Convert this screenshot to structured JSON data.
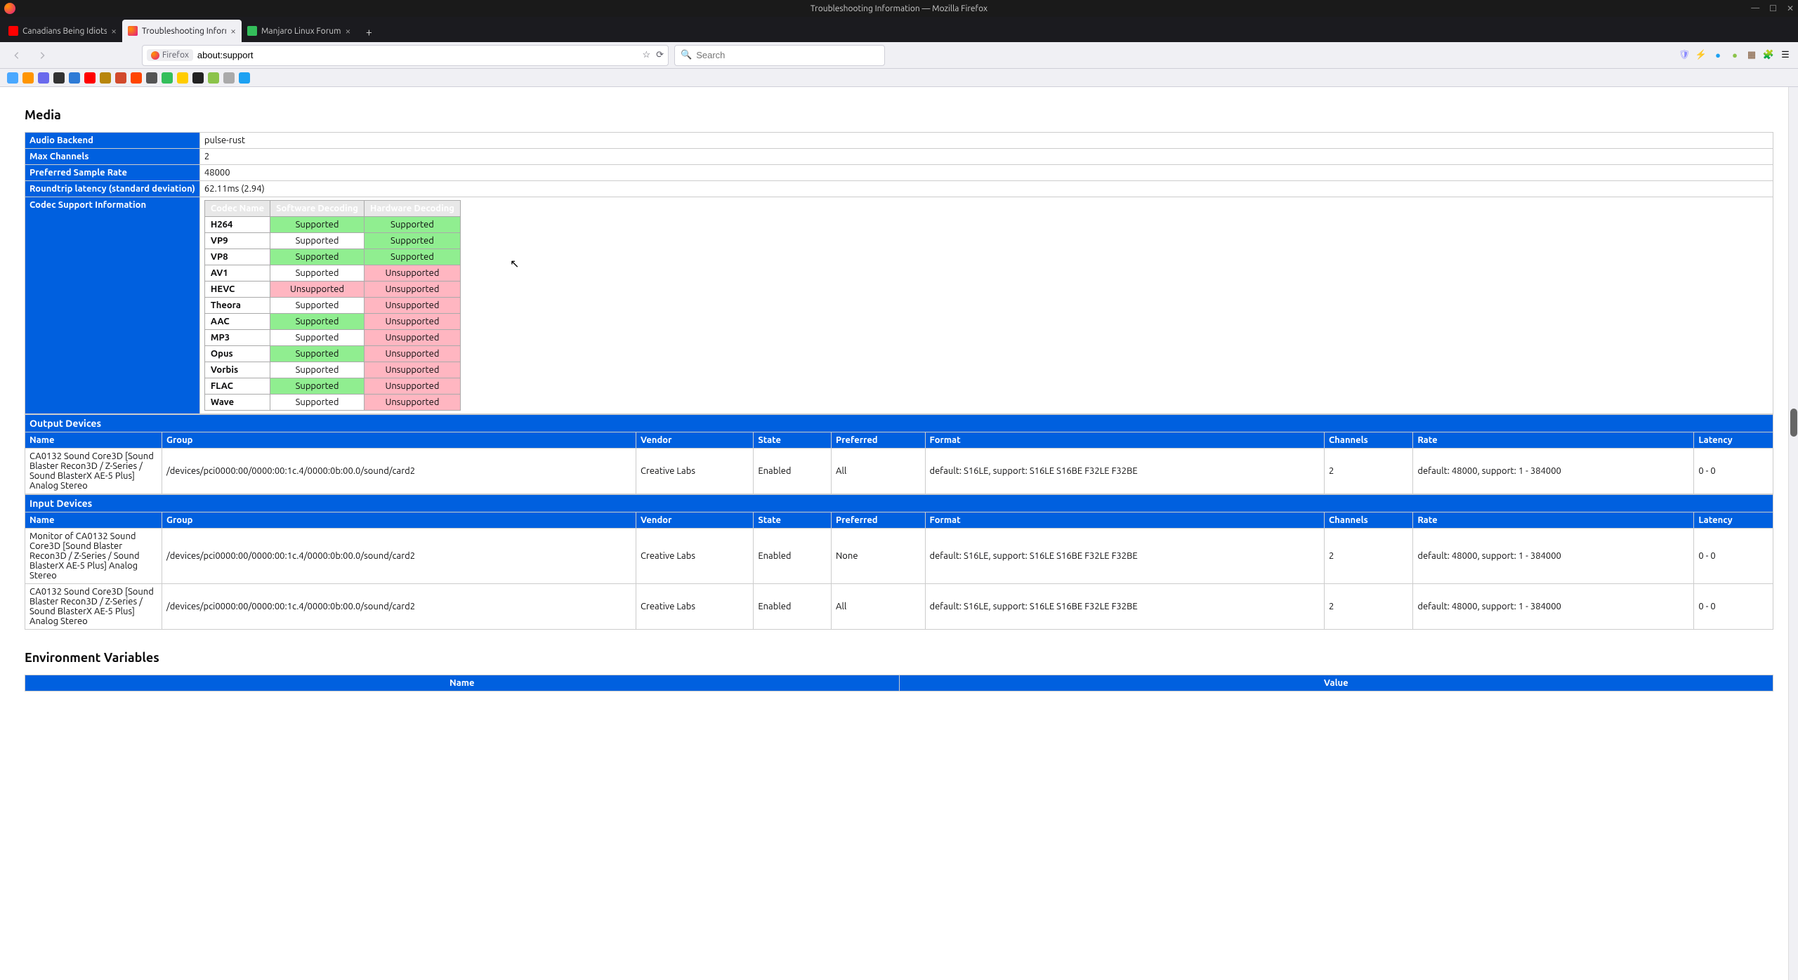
{
  "window": {
    "title": "Troubleshooting Information — Mozilla Firefox"
  },
  "tabs": [
    {
      "label": "Canadians Being Idiots | F",
      "active": false
    },
    {
      "label": "Troubleshooting Informati",
      "active": true
    },
    {
      "label": "Manjaro Linux Forum",
      "active": false
    }
  ],
  "urlbar": {
    "identity": "Firefox",
    "url": "about:support"
  },
  "searchbar": {
    "placeholder": "Search"
  },
  "media": {
    "section_title": "Media",
    "rows": {
      "audio_backend_label": "Audio Backend",
      "audio_backend_value": "pulse-rust",
      "max_channels_label": "Max Channels",
      "max_channels_value": "2",
      "sample_rate_label": "Preferred Sample Rate",
      "sample_rate_value": "48000",
      "latency_label": "Roundtrip latency (standard deviation)",
      "latency_value": "62.11ms (2.94)",
      "codec_label": "Codec Support Information"
    },
    "codec_headers": {
      "name": "Codec Name",
      "sw": "Software Decoding",
      "hw": "Hardware Decoding"
    },
    "codecs": [
      {
        "name": "H264",
        "sw": "Supported",
        "hw": "Supported",
        "sw_alt": false
      },
      {
        "name": "VP9",
        "sw": "Supported",
        "hw": "Supported",
        "sw_alt": true
      },
      {
        "name": "VP8",
        "sw": "Supported",
        "hw": "Supported",
        "sw_alt": false
      },
      {
        "name": "AV1",
        "sw": "Supported",
        "hw": "Unsupported",
        "sw_alt": true
      },
      {
        "name": "HEVC",
        "sw": "Unsupported",
        "hw": "Unsupported",
        "sw_alt": false
      },
      {
        "name": "Theora",
        "sw": "Supported",
        "hw": "Unsupported",
        "sw_alt": true
      },
      {
        "name": "AAC",
        "sw": "Supported",
        "hw": "Unsupported",
        "sw_alt": false
      },
      {
        "name": "MP3",
        "sw": "Supported",
        "hw": "Unsupported",
        "sw_alt": true
      },
      {
        "name": "Opus",
        "sw": "Supported",
        "hw": "Unsupported",
        "sw_alt": false
      },
      {
        "name": "Vorbis",
        "sw": "Supported",
        "hw": "Unsupported",
        "sw_alt": true
      },
      {
        "name": "FLAC",
        "sw": "Supported",
        "hw": "Unsupported",
        "sw_alt": false
      },
      {
        "name": "Wave",
        "sw": "Supported",
        "hw": "Unsupported",
        "sw_alt": true
      }
    ]
  },
  "devices": {
    "output_title": "Output Devices",
    "input_title": "Input Devices",
    "headers": {
      "name": "Name",
      "group": "Group",
      "vendor": "Vendor",
      "state": "State",
      "preferred": "Preferred",
      "format": "Format",
      "channels": "Channels",
      "rate": "Rate",
      "latency": "Latency"
    },
    "output": [
      {
        "name": "CA0132 Sound Core3D [Sound Blaster Recon3D / Z-Series / Sound BlasterX AE-5 Plus] Analog Stereo",
        "group": "/devices/pci0000:00/0000:00:1c.4/0000:0b:00.0/sound/card2",
        "vendor": "Creative Labs",
        "state": "Enabled",
        "preferred": "All",
        "format": "default: S16LE, support: S16LE S16BE F32LE F32BE",
        "channels": "2",
        "rate": "default: 48000, support: 1 - 384000",
        "latency": "0 - 0"
      }
    ],
    "input": [
      {
        "name": "Monitor of CA0132 Sound Core3D [Sound Blaster Recon3D / Z-Series / Sound BlasterX AE-5 Plus] Analog Stereo",
        "group": "/devices/pci0000:00/0000:00:1c.4/0000:0b:00.0/sound/card2",
        "vendor": "Creative Labs",
        "state": "Enabled",
        "preferred": "None",
        "format": "default: S16LE, support: S16LE S16BE F32LE F32BE",
        "channels": "2",
        "rate": "default: 48000, support: 1 - 384000",
        "latency": "0 - 0"
      },
      {
        "name": "CA0132 Sound Core3D [Sound Blaster Recon3D / Z-Series / Sound BlasterX AE-5 Plus] Analog Stereo",
        "group": "/devices/pci0000:00/0000:00:1c.4/0000:0b:00.0/sound/card2",
        "vendor": "Creative Labs",
        "state": "Enabled",
        "preferred": "All",
        "format": "default: S16LE, support: S16LE S16BE F32LE F32BE",
        "channels": "2",
        "rate": "default: 48000, support: 1 - 384000",
        "latency": "0 - 0"
      }
    ]
  },
  "env": {
    "section_title": "Environment Variables",
    "headers": {
      "name": "Name",
      "value": "Value"
    }
  },
  "bookmark_colors": [
    "#4aa8ff",
    "#ff9500",
    "#6a6aed",
    "#333",
    "#2e7bd6",
    "#f00",
    "#b8860b",
    "#d24a2c",
    "#ff4500",
    "#555",
    "#34be5b",
    "#ffcc00",
    "#222",
    "#8bc34a",
    "#aaa",
    "#1da1f2"
  ],
  "toolbar_icon_colors": [
    "#8a8aff",
    "#ff355e",
    "#1da1f2",
    "#8bc34a",
    "#7a5230"
  ]
}
